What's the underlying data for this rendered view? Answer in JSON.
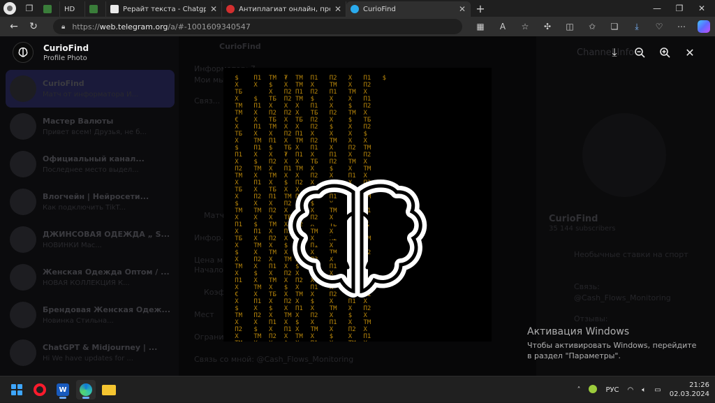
{
  "browser": {
    "tabs": [
      {
        "label": "",
        "kind": "mini"
      },
      {
        "label": "HD",
        "kind": "mini"
      },
      {
        "label": "",
        "kind": "mini"
      },
      {
        "label": "Рерайт текста - Chatgptweb.ru",
        "kind": "normal"
      },
      {
        "label": "Антиплагиат онлайн, проверка",
        "kind": "normal"
      },
      {
        "label": "CurioFind",
        "kind": "active"
      }
    ],
    "address": {
      "protocol": "https://",
      "host": "web.telegram.org",
      "path": "/a/#-1001609340547"
    }
  },
  "background": {
    "chats": [
      {
        "name": "CurioFind",
        "preview": "Матч от информатора И...",
        "selected": true
      },
      {
        "name": "Мастер Валюты",
        "preview": "Привет всем! Друзья, не б...",
        "selected": false
      },
      {
        "name": "Официальный канал...",
        "preview": "Последнее место выдел...",
        "selected": false
      },
      {
        "name": "Влогчейн | Нейросети...",
        "preview": "Как подключить TikT...",
        "selected": false
      },
      {
        "name": "ДЖИНСОВАЯ ОДЕЖДА „ S...",
        "preview": "НОВИНКИ Мас...",
        "selected": false
      },
      {
        "name": "Женская Одежда Оптом / ...",
        "preview": "НОВАЯ КОЛЛЕКЦИЯ К...",
        "selected": false
      },
      {
        "name": "Брендовая Женская Одеж...",
        "preview": "Новинка Стильна...",
        "selected": false
      },
      {
        "name": "ChatGPT & Midjourney | ...",
        "preview": "Hi We have updates for ...",
        "selected": false
      }
    ],
    "center_lines": [
      "CurioFind",
      "Информатор: 7...",
      "Мои мы...",
      "Связ...",
      "Матч",
      "Инфор...",
      "Цена м...",
      "Начало",
      "Коэф",
      "Мест",
      "Ограни",
      "Связь со мной: @Cash_Flows_Monitoring"
    ],
    "right_panel": {
      "title": "Channel Info",
      "name": "CurioFind",
      "subscribers": "35 144 subscribers",
      "lines": [
        "Необычные ставки на спорт",
        "Связь:",
        "@Cash_Flows_Monitoring",
        "Отзывы:"
      ]
    }
  },
  "viewer": {
    "channel_name": "CurioFind",
    "subtitle": "Profile Photo"
  },
  "watermark": {
    "title": "Активация Windows",
    "text": "Чтобы активировать Windows, перейдите в раздел \"Параметры\"."
  },
  "taskbar": {
    "language": "РУС",
    "time": "21:26",
    "date": "02.03.2024"
  }
}
